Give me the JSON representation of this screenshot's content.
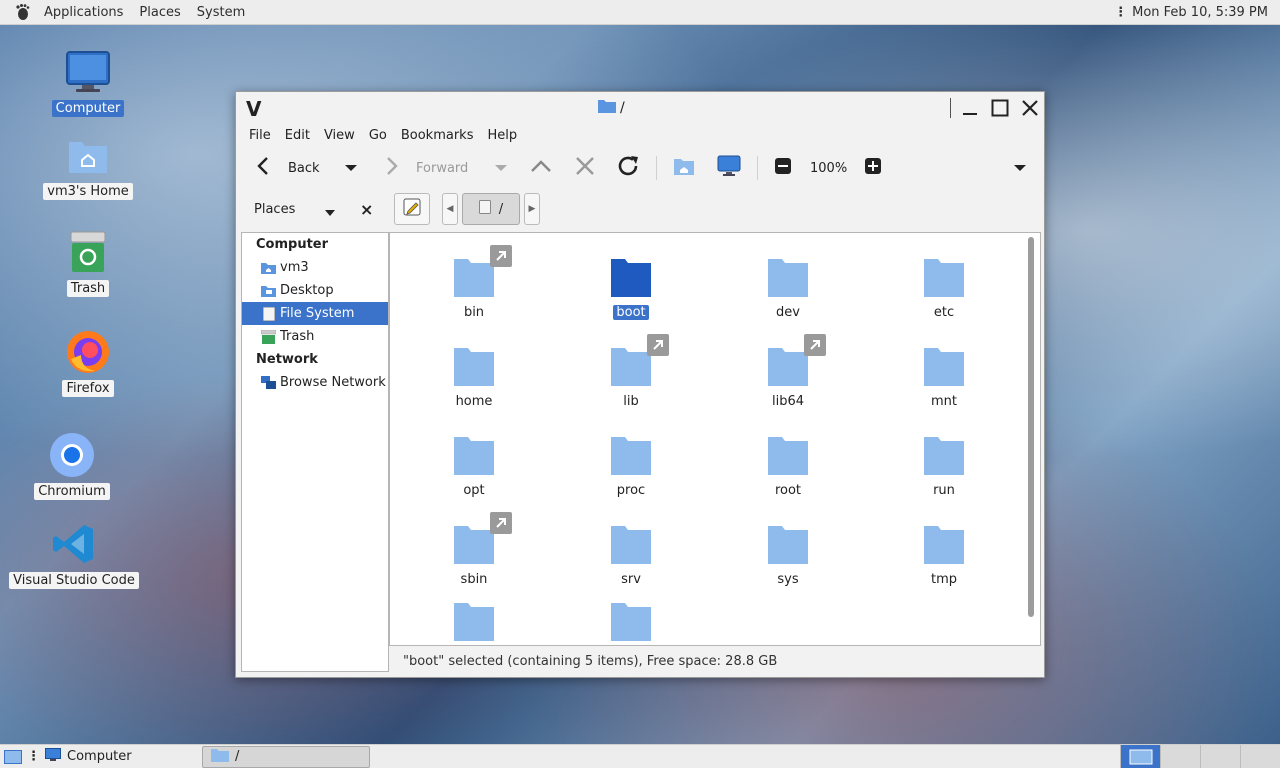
{
  "top_panel": {
    "menus": [
      "Applications",
      "Places",
      "System"
    ],
    "clock": "Mon Feb 10,  5:39 PM"
  },
  "desktop_icons": [
    {
      "label": "Computer",
      "icon": "monitor-icon"
    },
    {
      "label": "vm3's Home",
      "icon": "home-folder-icon"
    },
    {
      "label": "Trash",
      "icon": "trash-icon"
    },
    {
      "label": "Firefox",
      "icon": "firefox-icon"
    },
    {
      "label": "Chromium",
      "icon": "chromium-icon"
    },
    {
      "label": "Visual Studio Code",
      "icon": "vscode-icon"
    }
  ],
  "window": {
    "app_letter": "V",
    "title": "/",
    "menus": [
      "File",
      "Edit",
      "View",
      "Go",
      "Bookmarks",
      "Help"
    ],
    "toolbar": {
      "back_label": "Back",
      "forward_label": "Forward",
      "zoom": "100%"
    },
    "location": {
      "places_label": "Places",
      "path_label": "/"
    },
    "sidebar": {
      "computer_heading": "Computer",
      "network_heading": "Network",
      "items": [
        {
          "label": "vm3",
          "icon": "home-icon"
        },
        {
          "label": "Desktop",
          "icon": "desktop-icon"
        },
        {
          "label": "File System",
          "icon": "drive-icon",
          "selected": true
        },
        {
          "label": "Trash",
          "icon": "trash-icon"
        },
        {
          "label": "Browse Network",
          "icon": "network-icon"
        }
      ]
    },
    "files": [
      {
        "name": "bin",
        "link": true
      },
      {
        "name": "boot",
        "selected": true
      },
      {
        "name": "dev"
      },
      {
        "name": "etc"
      },
      {
        "name": "home"
      },
      {
        "name": "lib",
        "link": true
      },
      {
        "name": "lib64",
        "link": true
      },
      {
        "name": "mnt"
      },
      {
        "name": "opt"
      },
      {
        "name": "proc"
      },
      {
        "name": "root"
      },
      {
        "name": "run"
      },
      {
        "name": "sbin",
        "link": true
      },
      {
        "name": "srv"
      },
      {
        "name": "sys"
      },
      {
        "name": "tmp"
      },
      {
        "name": ""
      },
      {
        "name": ""
      }
    ],
    "status": "\"boot\" selected (containing 5 items), Free space: 28.8 GB"
  },
  "bottom_panel": {
    "tasks": [
      {
        "label": "Computer",
        "icon": "monitor-icon"
      },
      {
        "label": "/",
        "icon": "folder-icon"
      }
    ]
  },
  "colors": {
    "selection": "#3a73c9",
    "folder": "#8fbbec",
    "folder_selected": "#1f5bbf"
  }
}
